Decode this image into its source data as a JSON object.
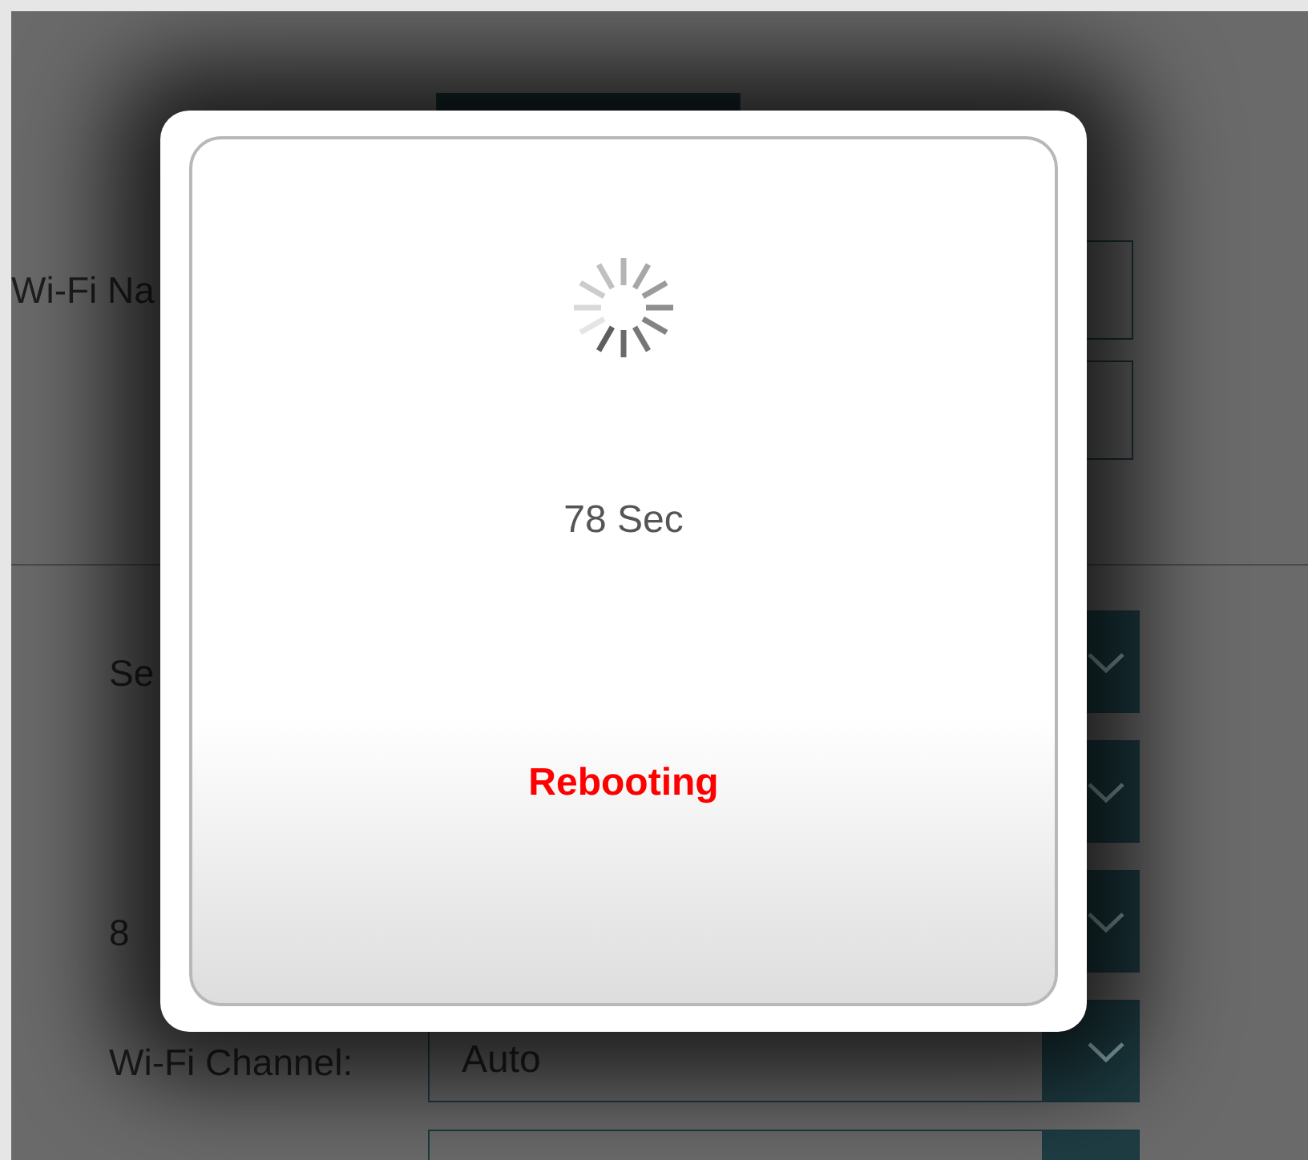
{
  "settings_form": {
    "top_fields": [
      {
        "kind": "text"
      },
      {
        "kind": "text",
        "label": "Wi-Fi Na"
      },
      {
        "kind": "text"
      }
    ],
    "rows": [
      {
        "kind": "select",
        "label": "Se"
      },
      {
        "kind": "select"
      },
      {
        "kind": "select",
        "label": "8"
      },
      {
        "kind": "select",
        "label": "Wi-Fi Channel:",
        "value": "Auto"
      },
      {
        "kind": "select"
      }
    ]
  },
  "dialog": {
    "countdown": "78 Sec",
    "status": "Rebooting"
  }
}
